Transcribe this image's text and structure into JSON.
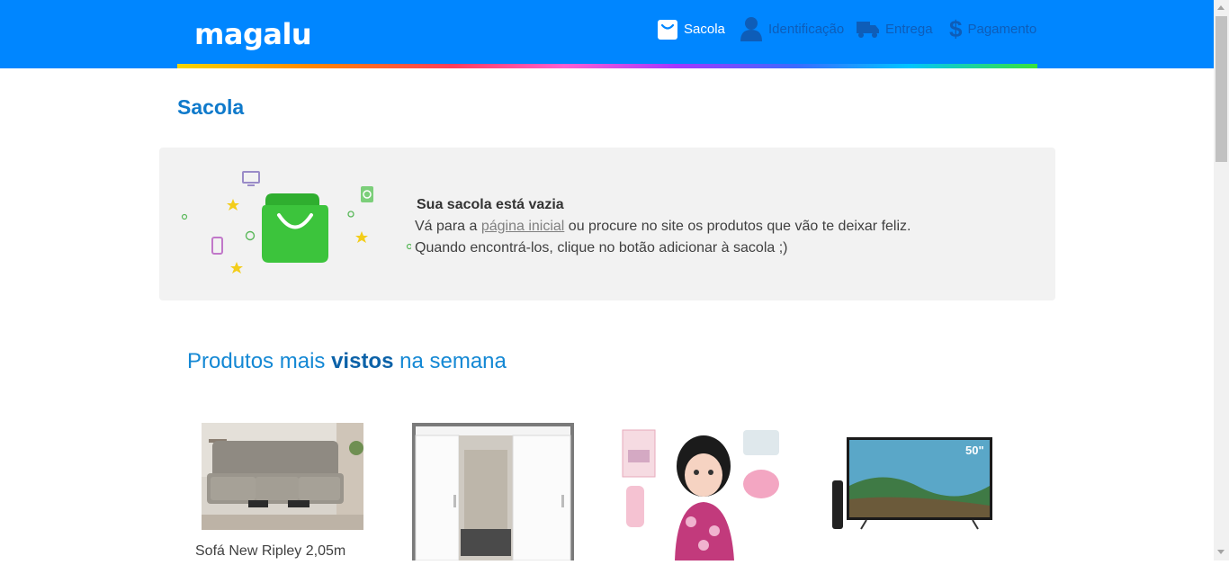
{
  "header": {
    "logo": "magalu",
    "steps": [
      {
        "label": "Sacola",
        "icon": "bag-icon",
        "active": true
      },
      {
        "label": "Identificação",
        "icon": "user-icon",
        "active": false
      },
      {
        "label": "Entrega",
        "icon": "truck-icon",
        "active": false
      },
      {
        "label": "Pagamento",
        "icon": "dollar-icon",
        "active": false
      }
    ]
  },
  "page": {
    "title": "Sacola"
  },
  "empty_cart": {
    "title": "Sua sacola está vazia",
    "line1_before": "Vá para a ",
    "link": "página inicial",
    "line1_after": " ou procure no site os produtos que vão te deixar feliz.",
    "line2": "Quando encontrá-los, clique no botão adicionar à sacola ;)"
  },
  "section": {
    "title_before": "Produtos mais ",
    "title_bold": "vistos",
    "title_after": " na semana"
  },
  "products": [
    {
      "name": "Sofá New Ripley 2,05m",
      "image": "sofa-image"
    },
    {
      "name": "",
      "image": "wardrobe-image"
    },
    {
      "name": "",
      "image": "doll-image"
    },
    {
      "name": "",
      "image": "tv-image",
      "badge": "50\""
    }
  ],
  "colors": {
    "header": "#0086ff",
    "title": "#0f7acb",
    "bag": "#3cc43c"
  }
}
